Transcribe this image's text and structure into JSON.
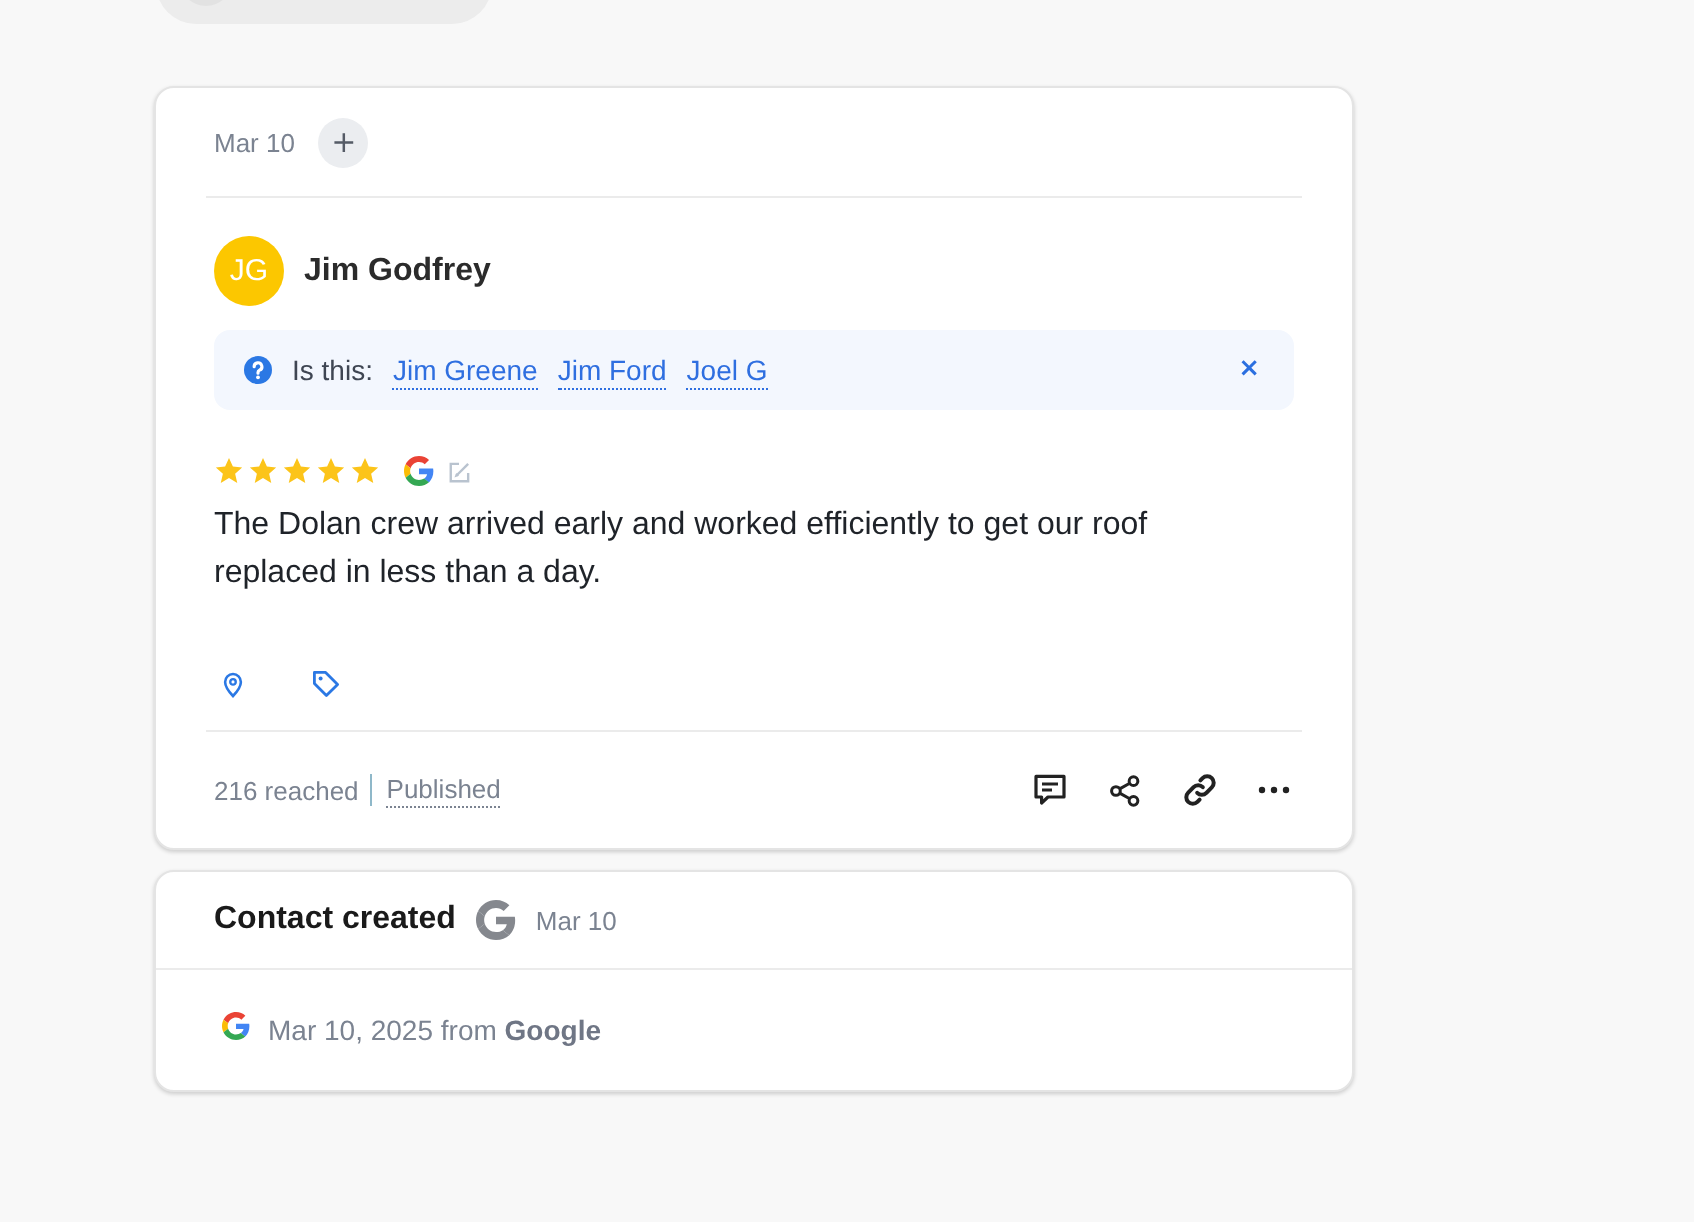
{
  "review_card": {
    "date": "Mar 10",
    "add_button": "+",
    "reviewer": {
      "initials": "JG",
      "name": "Jim Godfrey"
    },
    "suggestion": {
      "prompt": "Is this:",
      "names": [
        "Jim Greene",
        "Jim Ford",
        "Joel G"
      ],
      "close": "×"
    },
    "stars": 5,
    "text": "The Dolan crew arrived early and worked efficiently to get our roof replaced in less than a day.",
    "footer": {
      "reach": "216 reached",
      "status": "Published"
    }
  },
  "activity_card": {
    "title": "Contact created",
    "date": "Mar 10",
    "detail": "Mar 10, 2025 from **Google**"
  }
}
